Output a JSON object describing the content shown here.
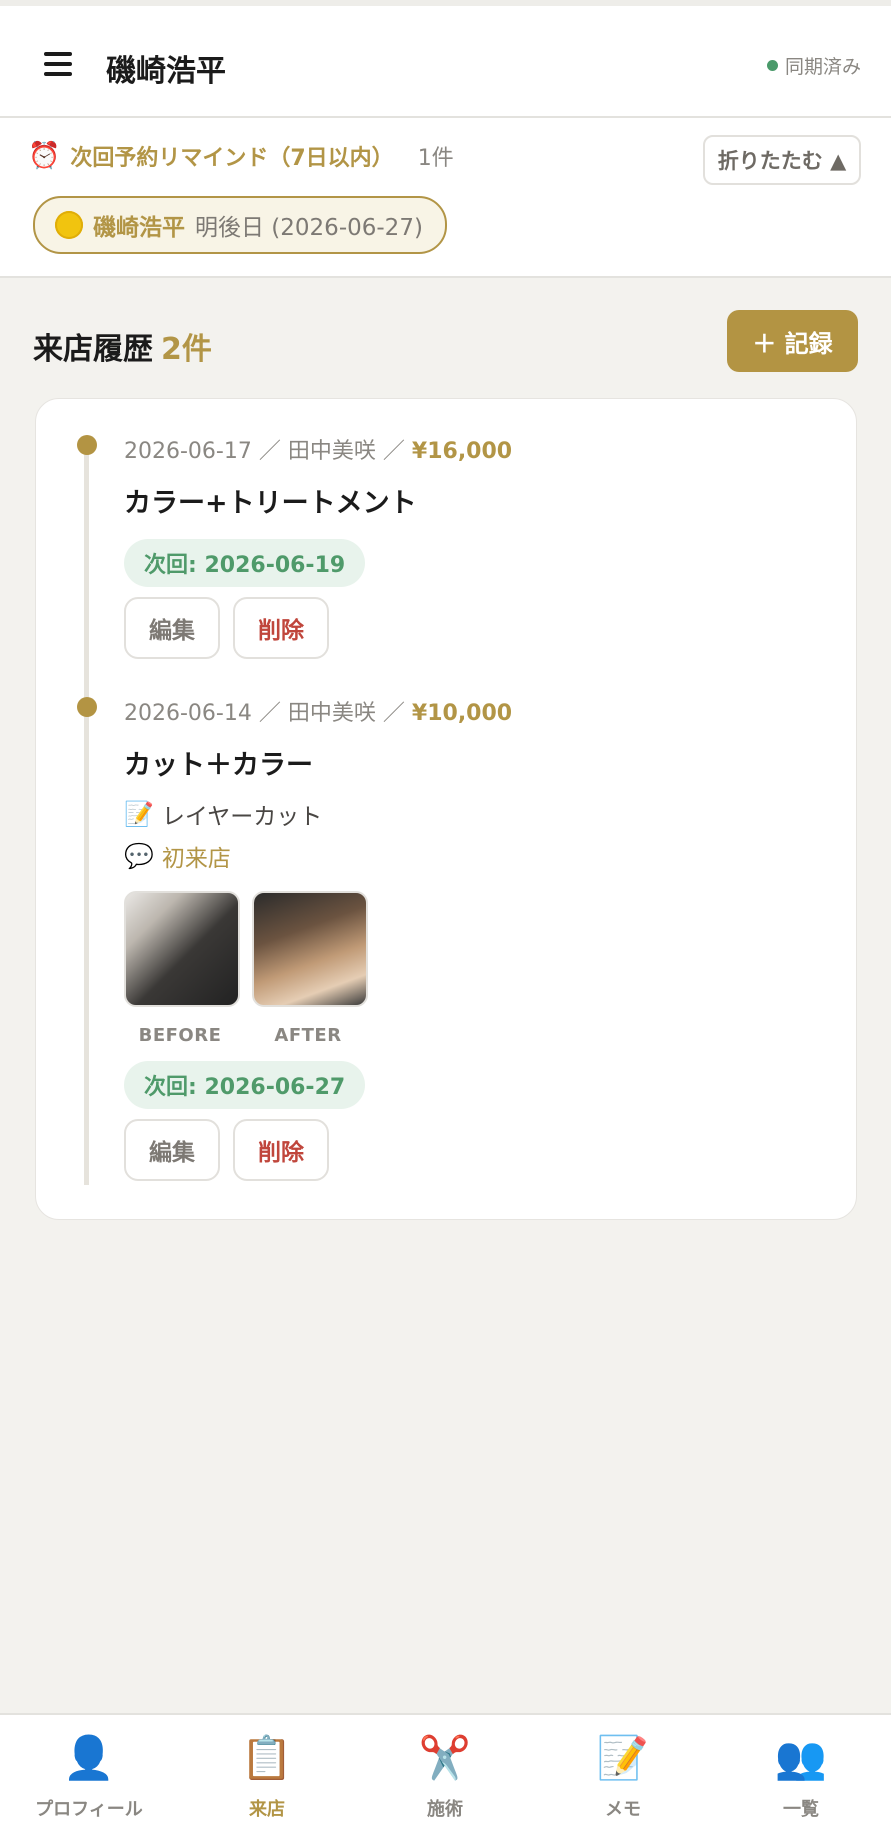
{
  "header": {
    "title": "磯崎浩平",
    "sync_status": "同期済み"
  },
  "reminder": {
    "title": "次回予約リマインド（7日以内）",
    "count": "1件",
    "collapse_label": "折りたたむ ▲",
    "items": [
      {
        "name": "磯崎浩平",
        "when": "明後日 (2026-06-27)"
      }
    ]
  },
  "visits": {
    "title": "来店履歴",
    "count": "2件",
    "add_label": "＋ 記録",
    "entries": [
      {
        "date": "2026-06-17",
        "staff": "田中美咲",
        "price": "¥16,000",
        "service": "カラー+トリートメント",
        "next": "次回: 2026-06-19",
        "edit_label": "編集",
        "delete_label": "削除"
      },
      {
        "date": "2026-06-14",
        "staff": "田中美咲",
        "price": "¥10,000",
        "service": "カット＋カラー",
        "note": "レイヤーカット",
        "comment": "初来店",
        "photo_before_label": "BEFORE",
        "photo_after_label": "AFTER",
        "next": "次回: 2026-06-27",
        "edit_label": "編集",
        "delete_label": "削除"
      }
    ]
  },
  "separator": "／",
  "bottom_nav": [
    {
      "label": "プロフィール",
      "icon": "👤",
      "icon_name": "profile-icon",
      "active": false
    },
    {
      "label": "来店",
      "icon": "📋",
      "icon_name": "clipboard-icon",
      "active": true
    },
    {
      "label": "施術",
      "icon": "✂️",
      "icon_name": "scissors-icon",
      "active": false
    },
    {
      "label": "メモ",
      "icon": "📝",
      "icon_name": "memo-icon",
      "active": false
    },
    {
      "label": "一覧",
      "icon": "👥",
      "icon_name": "users-icon",
      "active": false
    }
  ],
  "colors": {
    "accent": "#b39443",
    "sync": "#4a9a6a",
    "danger": "#c0463c",
    "next_bg": "#e8f3ec",
    "next_text": "#4f9a6a"
  }
}
